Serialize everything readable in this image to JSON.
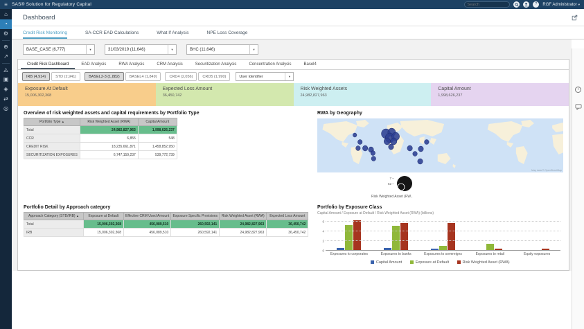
{
  "topbar": {
    "title": "SAS® Solution for Regulatory Capital",
    "search_placeholder": "Search",
    "user_menu": "RGF Administrator",
    "icons": {
      "menu": "≡",
      "help": "?"
    }
  },
  "page": {
    "title": "Dashboard"
  },
  "main_tabs": [
    {
      "label": "Credit Risk Monitoring",
      "active": true
    },
    {
      "label": "SA-CCR EAD Calculations",
      "active": false
    },
    {
      "label": "What If Analysis",
      "active": false
    },
    {
      "label": "NPE Loss Coverage",
      "active": false
    }
  ],
  "filters": [
    {
      "value": "BASE_CASE (6,777)"
    },
    {
      "value": "31/03/2019 (11,646)"
    },
    {
      "value": "BHC (11,646)"
    }
  ],
  "sub_tabs": [
    {
      "label": "Credit Risk Dashboard",
      "active": true
    },
    {
      "label": "EAD Analysis",
      "active": false
    },
    {
      "label": "RWA Analysis",
      "active": false
    },
    {
      "label": "CRM Analysis",
      "active": false
    },
    {
      "label": "Securitization Analysis",
      "active": false
    },
    {
      "label": "Concentration Analysis",
      "active": false
    },
    {
      "label": "Basel4",
      "active": false
    }
  ],
  "approach_toggles": [
    {
      "label": "IRB (4,914)",
      "selected": true
    },
    {
      "label": "STD (2,941)",
      "selected": false
    },
    {
      "label": "BASEL2-3 (1,882)",
      "selected": true
    },
    {
      "label": "BASEL4 (1,849)",
      "selected": false
    },
    {
      "label": "CRD4 (2,056)",
      "selected": false
    },
    {
      "label": "CRD5 (1,990)",
      "selected": false
    }
  ],
  "user_identifier": {
    "value": "User Identifier"
  },
  "kpis": [
    {
      "label": "Exposure At Default",
      "value": "15,006,302,368",
      "color": "#f8cd8b"
    },
    {
      "label": "Expected Loss Amount",
      "value": "36,450,742",
      "color": "#d3e8ae"
    },
    {
      "label": "Risk Weighted Assets",
      "value": "24,982,827,963",
      "color": "#cdeff1"
    },
    {
      "label": "Capital Amount",
      "value": "1,998,626,237",
      "color": "#e5d4f0"
    }
  ],
  "overview_table": {
    "title": "Overview of risk weighted assets and capital requirements by Portfolio Type",
    "columns": [
      "Portfolio Type",
      "Risk Weighted Asset (RWA)",
      "Capital Amount"
    ],
    "rows": [
      {
        "cells": [
          "Total",
          "24,982,827,963",
          "1,998,626,237"
        ],
        "highlight": true
      },
      {
        "cells": [
          "CCR",
          "6,855",
          "548"
        ],
        "highlight": false
      },
      {
        "cells": [
          "CREDIT RISK",
          "18,235,661,871",
          "1,458,852,950"
        ],
        "highlight": false
      },
      {
        "cells": [
          "SECURITIZATION EXPOSURES",
          "6,747,159,237",
          "539,772,739"
        ],
        "highlight": false
      }
    ]
  },
  "geo": {
    "title": "RWA by Geography",
    "attribution": "Map data © OpenStreetMap",
    "legend": {
      "caption": "Risk Weighted Asset (RW..",
      "min_label": "7",
      "max_label": "62"
    },
    "bubble_color": "#2c3f93",
    "bubbles": [
      {
        "x": 58,
        "y": 24,
        "r": 3
      },
      {
        "x": 66,
        "y": 34,
        "r": 3.5
      },
      {
        "x": 63,
        "y": 43,
        "r": 3.5
      },
      {
        "x": 74,
        "y": 43,
        "r": 4
      },
      {
        "x": 83,
        "y": 45,
        "r": 4
      },
      {
        "x": 86,
        "y": 50,
        "r": 3.5
      },
      {
        "x": 87,
        "y": 58,
        "r": 3.5
      },
      {
        "x": 106,
        "y": 22,
        "r": 7
      },
      {
        "x": 115,
        "y": 20,
        "r": 6
      },
      {
        "x": 112,
        "y": 28,
        "r": 7
      },
      {
        "x": 121,
        "y": 26,
        "r": 6
      },
      {
        "x": 108,
        "y": 33,
        "r": 5
      },
      {
        "x": 118,
        "y": 33,
        "r": 5
      },
      {
        "x": 114,
        "y": 41,
        "r": 4
      },
      {
        "x": 143,
        "y": 43,
        "r": 4
      },
      {
        "x": 151,
        "y": 51,
        "r": 3.5
      },
      {
        "x": 160,
        "y": 44,
        "r": 4
      },
      {
        "x": 169,
        "y": 34,
        "r": 3.5
      },
      {
        "x": 159,
        "y": 62,
        "r": 4
      }
    ]
  },
  "detail_table": {
    "title": "Portfolio Detail by Approach category",
    "columns": [
      "Approach Category (STD/IRB)",
      "Exposure at Default",
      "Effective CRM Used Amount",
      "Exposure Specific Provisions",
      "Risk Weighted Asset (RWA)",
      "Expected Loss Amount"
    ],
    "rows": [
      {
        "cells": [
          "Total",
          "15,006,302,368",
          "456,089,510",
          "260,592,141",
          "24,982,827,963",
          "36,450,742"
        ],
        "highlight": true
      },
      {
        "cells": [
          "IRB",
          "15,006,302,368",
          "456,089,510",
          "260,592,141",
          "24,982,827,963",
          "36,450,742"
        ],
        "highlight": false
      }
    ]
  },
  "chart_data": {
    "type": "bar",
    "title": "Portfolio by Exposure Class",
    "subtitle": "Capital Amount / Exposure at Default / Risk Weighted Asset (RWA) (billions)",
    "categories": [
      "Exposures to corporates",
      "Exposures to banks",
      "Exposures to sovereigns",
      "Exposures to retail",
      "Equity exposures"
    ],
    "series": [
      {
        "name": "Capital Amount",
        "color": "#3a63ad",
        "values": [
          0.5,
          0.45,
          0.35,
          0.05,
          0.02
        ]
      },
      {
        "name": "Exposure at Default",
        "color": "#90b83a",
        "values": [
          5.3,
          5.1,
          0.9,
          1.3,
          0
        ]
      },
      {
        "name": "Risk Weighted Asset (RWA)",
        "color": "#a6341f",
        "values": [
          6.3,
          5.7,
          5.6,
          0.35,
          0.4
        ]
      }
    ],
    "xlabel": "",
    "ylabel": "",
    "ylim": [
      0,
      6.6
    ],
    "yticks": [
      0,
      2,
      4,
      6
    ],
    "grid": "horizontal-dotted",
    "legend_position": "bottom"
  },
  "sidebar": {
    "items": [
      {
        "name": "home",
        "glyph": "⌂",
        "active": false
      },
      {
        "name": "dashboard",
        "glyph": "◔",
        "active": true
      },
      {
        "name": "settings",
        "glyph": "⚙",
        "active": false
      },
      {
        "divider": true
      },
      {
        "name": "globe",
        "glyph": "⊕",
        "active": false
      },
      {
        "name": "trend",
        "glyph": "↗",
        "active": false
      },
      {
        "divider": true
      },
      {
        "name": "hierarchy",
        "glyph": "◬",
        "active": false
      },
      {
        "name": "reports",
        "glyph": "▣",
        "active": false
      },
      {
        "name": "tags",
        "glyph": "◈",
        "active": false
      },
      {
        "name": "transfer",
        "glyph": "⇄",
        "active": false
      },
      {
        "name": "models",
        "glyph": "◎",
        "active": false
      }
    ]
  },
  "rail": {
    "info_glyph": "i"
  },
  "ui": {
    "sort_asc": "▲",
    "caret": "▾"
  }
}
